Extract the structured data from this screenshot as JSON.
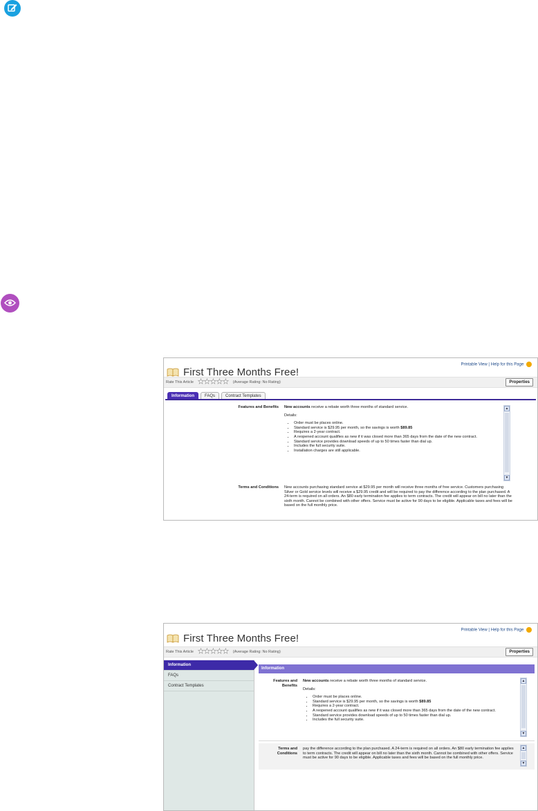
{
  "colors": {
    "note_icon": "#1aa1e0",
    "preview_icon": "#b04fbf",
    "tab_active": "#4a2fb4",
    "section_header": "#7f72d2"
  },
  "icons": {
    "note": "note-edit-icon",
    "preview": "eye-icon",
    "article": "open-book-icon",
    "help": "help-icon"
  },
  "article": {
    "printable_view": "Printable View",
    "help_link": "Help for this Page",
    "title": "First Three Months Free!",
    "rate_label": "Rate This Article",
    "rating_text": "(Average Rating: No Rating)",
    "properties_button": "Properties"
  },
  "tabs": [
    "Information",
    "FAQs",
    "Contract Templates"
  ],
  "sections": {
    "info_header": "Information",
    "features_label": "Features and Benefits",
    "features_label_line1": "Features and",
    "features_label_line2": "Benefits",
    "features_intro_bold": "New accounts",
    "features_intro_rest": " receive a rebate worth three months of standard service.",
    "details_label": "Details:",
    "bullets": [
      "Order must be places online.",
      "Standard service is $29.95 per month, so the savings is worth ",
      "Requires a 2-year contract.",
      "A reopened account qualifies as new if it was closed more than 365 days from the date of the new contract.",
      "Standard service provides download speeds of up to 50 times faster than dial up.",
      "Includes the full security suite.",
      "Installation charges are still applicable."
    ],
    "savings_amount_1": "$89.85",
    "savings_amount_2": "$89.85",
    "terms_label": "Terms and Conditions",
    "terms_label_line1": "Terms and",
    "terms_label_line2": "Conditions",
    "terms_text": "New accounts purchasing standard service at $29.95 per month will receive three months of free service. Customers purchasing Silver or Gold service levels will receive a $29.95 credit and will be required to pay the difference according to the plan purchased. A 24-term is required on all orders. An $80 early termination fee applies to term contracts. The credit will appear on bill no later than the sixth month. Cannot be combined with other offers. Service must be active for 90 days to be eligible. Applicable taxes and fees will be based on the full monthly price.",
    "terms_text_scrolled": "pay the difference according to the plan purchased. A 24-term is required on all orders. An $80 early termination fee applies to term contracts. The credit will appear on bill no later than the sixth month. Cannot be combined with other offers. Service must be active for 90 days to be eligible. Applicable taxes and fees will be based on the full monthly price."
  }
}
